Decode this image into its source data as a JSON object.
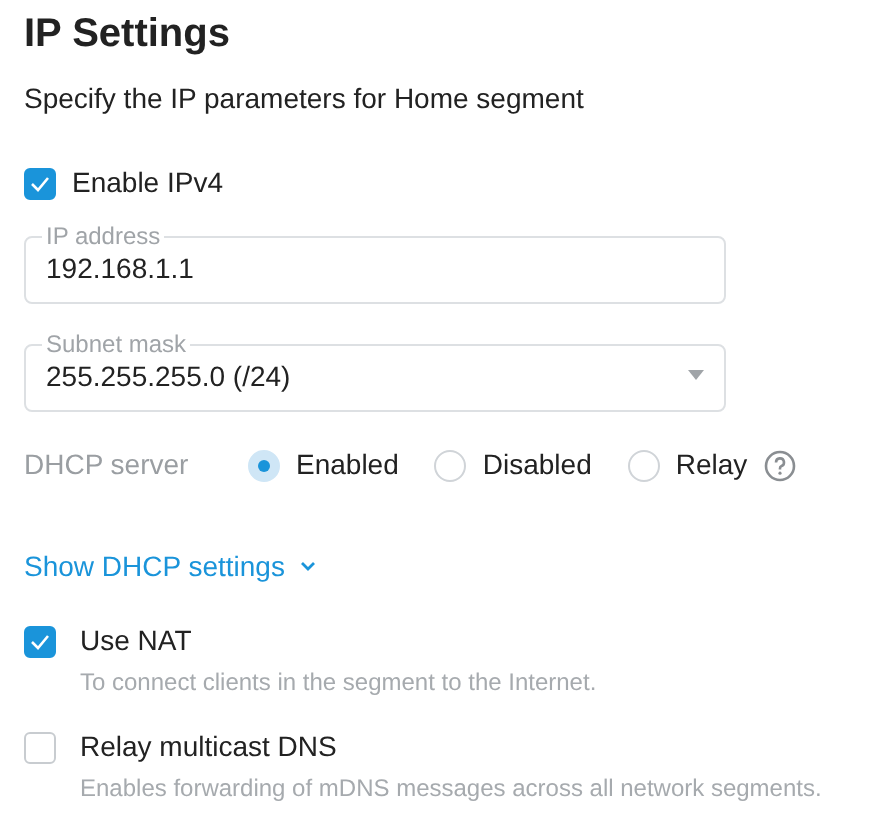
{
  "title": "IP Settings",
  "subtitle": "Specify the IP parameters for Home segment",
  "enable_ipv4": {
    "label": "Enable IPv4",
    "checked": true
  },
  "fields": [
    {
      "kind": "text",
      "label": "IP address",
      "value": "192.168.1.1"
    },
    {
      "kind": "select",
      "label": "Subnet mask",
      "value": "255.255.255.0 (/24)"
    }
  ],
  "dhcp_server": {
    "label": "DHCP server",
    "options": [
      {
        "label": "Enabled",
        "selected": true
      },
      {
        "label": "Disabled",
        "selected": false
      },
      {
        "label": "Relay",
        "selected": false
      }
    ]
  },
  "dhcp_link": {
    "label": "Show DHCP settings",
    "expanded": false
  },
  "options": [
    {
      "label": "Use NAT",
      "hint": "To connect clients in the segment to the Internet.",
      "checked": true
    },
    {
      "label": "Relay multicast DNS",
      "hint": "Enables forwarding of mDNS messages across all network segments.",
      "checked": false
    }
  ]
}
